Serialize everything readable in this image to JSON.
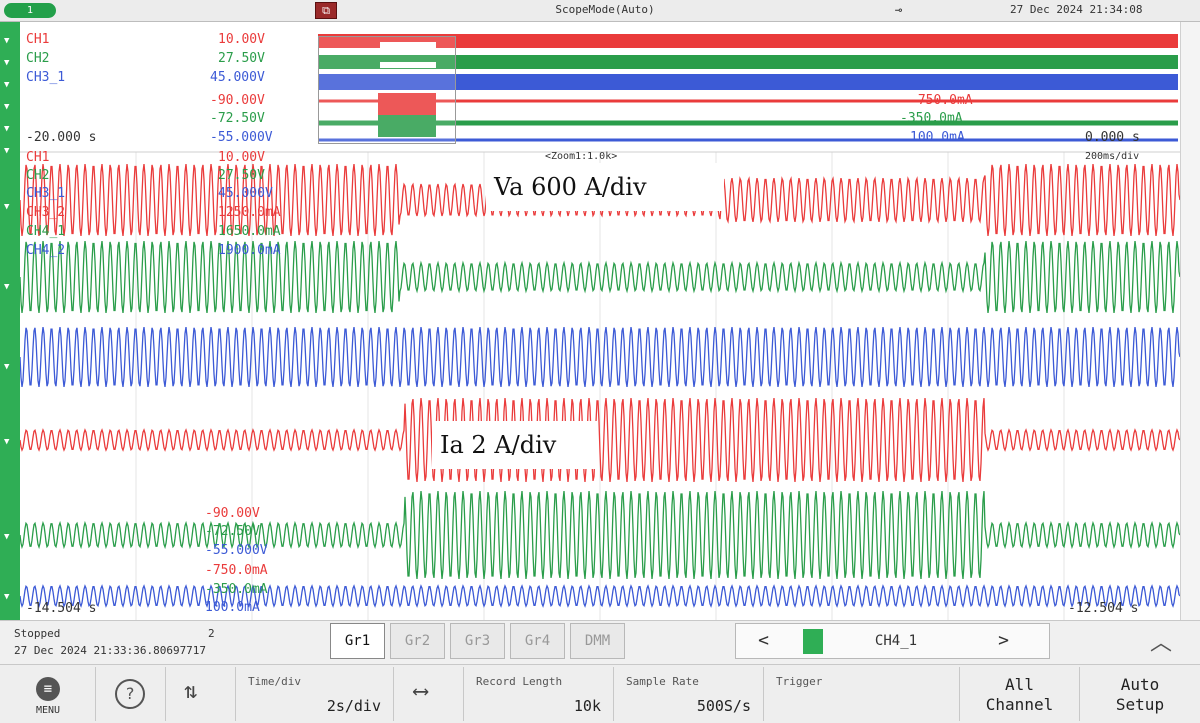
{
  "top": {
    "badge": "1",
    "scope_icon": "zoom-scope-icon",
    "mode": "ScopeMode(Auto)",
    "plug_icon": "power-plug-icon",
    "datetime": "27 Dec 2024 21:34:08"
  },
  "overview": {
    "rows": [
      {
        "name": "CH1",
        "value": "10.00V"
      },
      {
        "name": "CH2",
        "value": "27.50V"
      },
      {
        "name": "CH3_1",
        "value": "45.000V"
      },
      {
        "name": "",
        "value": "-90.00V"
      },
      {
        "name": "",
        "value": "-72.50V"
      },
      {
        "name": "-20.000 s",
        "value": "-55.000V"
      }
    ],
    "right_values": [
      "-750.0mA",
      "-350.0mA",
      "100.0mA"
    ],
    "right_time": "0.000 s",
    "zoom_label": "<Zoom1:1.0k>",
    "time_per_div": "200ms/div"
  },
  "zoom": {
    "labels": [
      {
        "name": "CH1",
        "value": "10.00V"
      },
      {
        "name": "CH2",
        "value": "27.50V"
      },
      {
        "name": "CH3_1",
        "value": "45.000V"
      },
      {
        "name": "CH3_2",
        "value": "1250.0mA"
      },
      {
        "name": "CH4_1",
        "value": "1650.0mA"
      },
      {
        "name": "CH4_2",
        "value": "1900.0mA"
      }
    ],
    "bottom_values": [
      "-90.00V",
      "-72.50V",
      "-55.000V",
      "-750.0mA",
      "-350.0mA",
      "100.0mA"
    ],
    "left_time": "-14.504 s",
    "right_time": "-12.504 s"
  },
  "annotations": {
    "va": "Va 600 A/div",
    "ia": "Ia 2 A/div"
  },
  "colors": {
    "ch1": "#ea3b3b",
    "ch2": "#2a9d4a",
    "ch3": "#3c5ad6",
    "rail": "#2fae55"
  },
  "status": {
    "state": "Stopped",
    "count": "2",
    "timestamp": "27 Dec 2024 21:33:36.80697717"
  },
  "tabs": [
    "Gr1",
    "Gr2",
    "Gr3",
    "Gr4",
    "DMM"
  ],
  "active_tab": "Gr1",
  "channel_nav": {
    "prev": "<",
    "next": ">",
    "channel": "CH4_1"
  },
  "collapse_icon": "chevron-up-icon",
  "toolbar": {
    "menu_label": "MENU",
    "help_icon": "help-icon",
    "autoscale_icon": "autoscale-icon",
    "time_div_title": "Time/div",
    "time_div_value": "2s/div",
    "trigger_mode_icon": "trigger-mode-icon",
    "record_length_title": "Record Length",
    "record_length_value": "10k",
    "sample_rate_title": "Sample Rate",
    "sample_rate_value": "500S/s",
    "trigger_title": "Trigger",
    "all_channel_1": "All",
    "all_channel_2": "Channel",
    "auto_setup_1": "Auto",
    "auto_setup_2": "Setup"
  }
}
